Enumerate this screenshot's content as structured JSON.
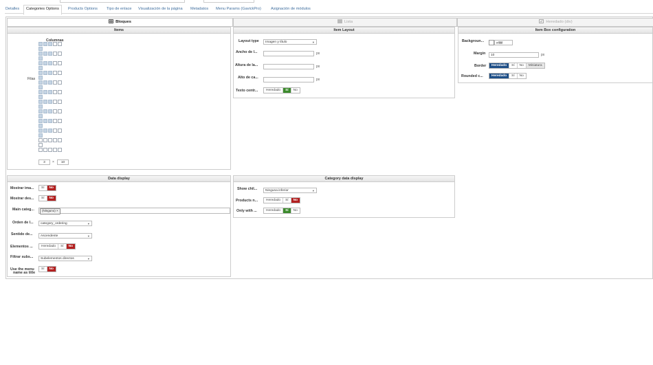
{
  "tabs": [
    {
      "label": "Detalles",
      "active": false
    },
    {
      "label": "Categories Options",
      "active": true
    },
    {
      "label": "Products Options",
      "active": false
    },
    {
      "label": "Tipo de enlace",
      "active": false
    },
    {
      "label": "Visualización de la página",
      "active": false
    },
    {
      "label": "Metadatos",
      "active": false
    },
    {
      "label": "Menu Params (GavickPro)",
      "active": false
    },
    {
      "label": "Asignación de módulos",
      "active": false
    }
  ],
  "layout_tabs": [
    {
      "label": "Bloques",
      "state": "active"
    },
    {
      "label": "Lista",
      "state": "disabled"
    },
    {
      "label": "Heredado (div)",
      "state": "disabled"
    }
  ],
  "items_panel": {
    "title": "Items",
    "columns_label": "Columnas",
    "rows_label": "Filas",
    "grid": {
      "columns": 5,
      "rows": 12,
      "selected_columns": 3,
      "selected_rows": 10
    },
    "cols_value": "3",
    "times": "×",
    "rows_value": "10"
  },
  "item_layout": {
    "title": "Item Layout",
    "layout_type_label": "Layout type",
    "layout_type_value": "Imagen y título",
    "width_label": "Ancho de l...",
    "height_label": "Altura de la...",
    "alto_label": "Alto de ca...",
    "unit": "px",
    "text_center_label": "Texto centr...",
    "text_center_options": [
      "Heredado",
      "Sí",
      "No"
    ],
    "text_center_selected": "Sí"
  },
  "item_box": {
    "title": "Item Box configuration",
    "background_label": "Backgroun...",
    "background_value": "#ffffff",
    "margin_label": "Margin",
    "margin_value": "10",
    "unit": "px",
    "border_label": "Border",
    "border_options": [
      "Heredado",
      "Sí",
      "No",
      "Miniatura"
    ],
    "border_selected": "Heredado",
    "rounded_label": "Rounded c...",
    "rounded_options": [
      "Heredado",
      "Sí",
      "No"
    ],
    "rounded_selected": "Heredado"
  },
  "data_display": {
    "title": "Data display",
    "mostrar_ima_label": "Mostrar ima...",
    "mostrar_ima_options": [
      "Sí",
      "No"
    ],
    "mostrar_des_label": "Mostrar des...",
    "mostrar_des_options": [
      "Sí",
      "No"
    ],
    "main_categ_label": "Main categ...",
    "main_categ_chip": "(Ninguno) ×",
    "orden_label": "Orden de l...",
    "orden_value": "category_ordering",
    "sentido_label": "Sentido de...",
    "sentido_value": "Ascendente",
    "elementos_label": "Elementos ...",
    "elementos_options": [
      "Heredado",
      "Sí",
      "No"
    ],
    "filtrar_label": "Filtrar subs...",
    "filtrar_value": "Subelementos directos",
    "use_menu_label_1": "Use the menu",
    "use_menu_label_2": "name as title",
    "use_menu_options": [
      "Sí",
      "No"
    ]
  },
  "category_data": {
    "title": "Category data display",
    "show_child_label": "Show chil...",
    "show_child_value": "Ninguna inferior",
    "products_label": "Products n...",
    "products_options": [
      "Heredado",
      "Sí",
      "No"
    ],
    "only_with_label": "Only with ...",
    "only_with_options": [
      "Heredado",
      "Sí",
      "No"
    ]
  },
  "colors": {
    "red": "#b32020",
    "green": "#3b8a2c",
    "blue": "#1f4f87",
    "link": "#3f6e9e"
  }
}
